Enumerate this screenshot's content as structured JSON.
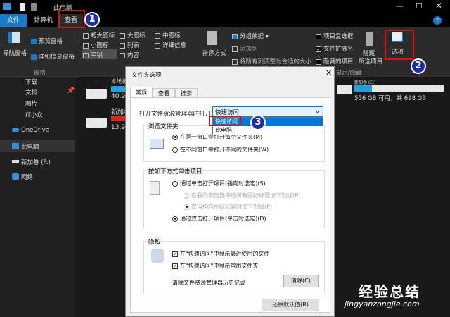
{
  "window": {
    "title": "此电脑"
  },
  "tabs": [
    "文件",
    "计算机",
    "查看"
  ],
  "ribbon": {
    "panes": {
      "nav": "导航窗格",
      "preview": "预览窗格",
      "details": "详细信息窗格",
      "group": "窗格"
    },
    "layout": [
      "超大图标",
      "大图标",
      "中图标",
      "小图标",
      "列表",
      "详细信息",
      "平铺",
      "内容"
    ],
    "view": {
      "sort": "排序方式",
      "groupby": "分组依据",
      "addcol": "添加列",
      "fit": "将所有列调整为合适的大小"
    },
    "show": {
      "checkboxes": "项目复选框",
      "extensions": "文件扩展名",
      "hidden": "隐藏的项目",
      "hide_sel": "隐藏",
      "hide_sel2": "所选项目",
      "group": "显示/隐藏"
    },
    "options": "选项"
  },
  "nav": [
    "下载",
    "文档",
    "图片",
    "IT小众",
    "OneDrive",
    "此电脑",
    "新加卷 (F:)",
    "网络"
  ],
  "drives": [
    {
      "name": "本地磁盘",
      "free": "40.9",
      "fill": 0.6,
      "color": "#26a0da"
    },
    {
      "name": "新加卷",
      "free": "13.9",
      "fill": 0.9,
      "color": "#da2626"
    }
  ],
  "drive_right": {
    "name": "新加卷 (E:)",
    "info": "556 GB 可用，共 698 GB",
    "fill": 0.2
  },
  "dialog": {
    "title": "文件夹选项",
    "tabs": [
      "常规",
      "查看",
      "搜索"
    ],
    "open_label": "打开文件资源管理器时打开:",
    "open_value": "快速访问",
    "dropdown_options": [
      "快速访问",
      "此电脑"
    ],
    "browse": {
      "title": "浏览文件夹",
      "opt1": "在同一窗口中打开每个文件夹(M)",
      "opt2": "在不同窗口中打开不同的文件夹(W)"
    },
    "click": {
      "title": "按如下方式单击项目",
      "opt1": "通过单击打开项目(指向时选定)(S)",
      "sub1": "在我的浏览器中给所有图标标题加下划线(B)",
      "sub2": "仅当指向图标标题时加下划线(P)",
      "opt2": "通过双击打开项目(单击时选定)(D)"
    },
    "privacy": {
      "title": "隐私",
      "cb1": "在\"快速访问\"中显示最近使用的文件",
      "cb2": "在\"快速访问\"中显示常用文件夹",
      "clear_label": "清除文件资源管理器历史记录",
      "clear_btn": "清除(C)"
    },
    "restore": "还原默认值(R)"
  },
  "annotations": [
    "1",
    "2",
    "3"
  ],
  "watermark": {
    "text": "经验总结",
    "url": "jingyanzongjie.com"
  }
}
